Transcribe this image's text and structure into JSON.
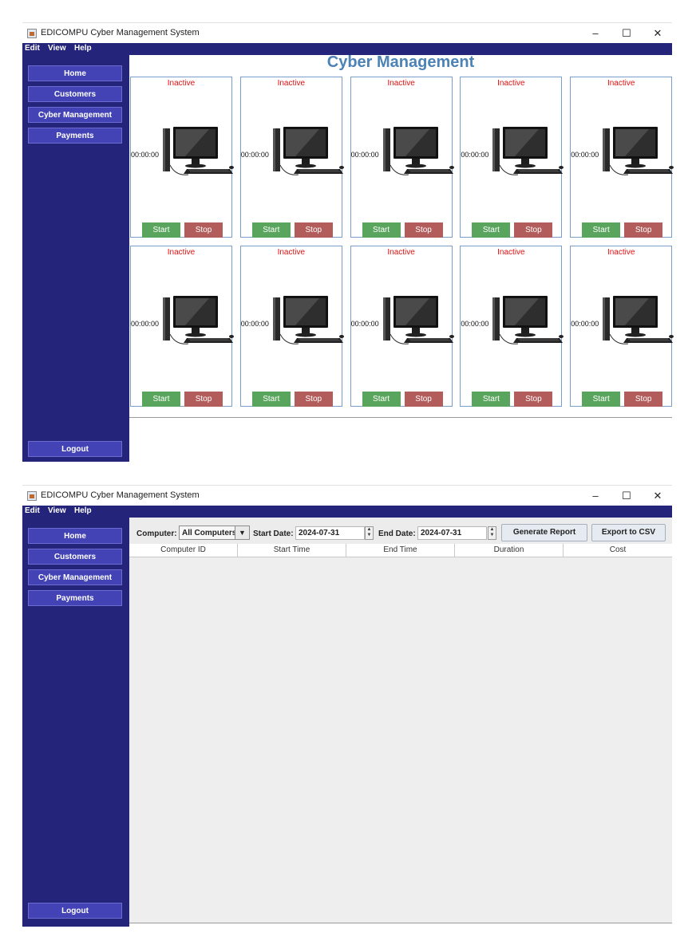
{
  "app": {
    "title": "EDICOMPU Cyber Management System",
    "window_controls": {
      "minimize": "–",
      "maximize": "☐",
      "close": "✕"
    },
    "menu": [
      "Edit",
      "View",
      "Help"
    ]
  },
  "sidebar": {
    "items": [
      {
        "label": "Home"
      },
      {
        "label": "Customers"
      },
      {
        "label": "Cyber Management"
      },
      {
        "label": "Payments"
      }
    ],
    "logout_label": "Logout"
  },
  "cyber_management": {
    "page_title": "Cyber Management",
    "computers": [
      {
        "status": "Inactive",
        "time": "00:00:00",
        "start_label": "Start",
        "stop_label": "Stop"
      },
      {
        "status": "Inactive",
        "time": "00:00:00",
        "start_label": "Start",
        "stop_label": "Stop"
      },
      {
        "status": "Inactive",
        "time": "00:00:00",
        "start_label": "Start",
        "stop_label": "Stop"
      },
      {
        "status": "Inactive",
        "time": "00:00:00",
        "start_label": "Start",
        "stop_label": "Stop"
      },
      {
        "status": "Inactive",
        "time": "00:00:00",
        "start_label": "Start",
        "stop_label": "Stop"
      },
      {
        "status": "Inactive",
        "time": "00:00:00",
        "start_label": "Start",
        "stop_label": "Stop"
      },
      {
        "status": "Inactive",
        "time": "00:00:00",
        "start_label": "Start",
        "stop_label": "Stop"
      },
      {
        "status": "Inactive",
        "time": "00:00:00",
        "start_label": "Start",
        "stop_label": "Stop"
      },
      {
        "status": "Inactive",
        "time": "00:00:00",
        "start_label": "Start",
        "stop_label": "Stop"
      },
      {
        "status": "Inactive",
        "time": "00:00:00",
        "start_label": "Start",
        "stop_label": "Stop"
      }
    ]
  },
  "payments": {
    "computer_label": "Computer:",
    "computer_value": "All Computers",
    "start_date_label": "Start Date:",
    "start_date_value": "2024-07-31",
    "end_date_label": "End Date:",
    "end_date_value": "2024-07-31",
    "generate_label": "Generate Report",
    "export_label": "Export to CSV",
    "columns": [
      "Computer ID",
      "Start Time",
      "End Time",
      "Duration",
      "Cost"
    ]
  },
  "colors": {
    "sidebar": "#24247a",
    "sidebar_button": "#4343b6",
    "title": "#4c82b6",
    "status_inactive": "#e01010",
    "start_button": "#5aa55d",
    "stop_button": "#b35c5c"
  }
}
